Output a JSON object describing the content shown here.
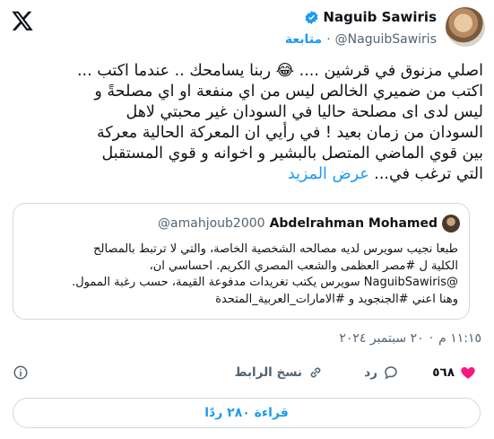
{
  "author": {
    "name": "Naguib Sawiris",
    "handle": "@NaguibSawiris",
    "follow_label": "متابعة",
    "dot": "·"
  },
  "tweet": {
    "lines": [
      "اصلي مزنوق في قرشين .... 😂 ربنا يسامحك .. عندما  اكتب ...",
      "اكتب من ضميري الخالص ليس من اي منفعة او اي مصلحةً و",
      "ليس لدى اى  مصلحة حاليا في السودان غير محبتي لاهل",
      "السودان من زمان بعيد ! في رأيي  ان المعركة الحالية معركة",
      "بين قوي الماضي المتصل بالبشير و اخوانه و قوي المستقبل"
    ],
    "last_line": "التي ترغب في...",
    "more_label": "عرض المزيد"
  },
  "quote": {
    "name": "Abdelrahman Mohamed",
    "handle": "@amahjoub2000",
    "lines": [
      "طبعا نجيب سويرس لديه مصالحه الشخصية الخاصة، والتي لا ترتبط بالمصالح",
      "الكلية ل #مصر العظمى والشعب المصري الكريم. احساسي ان،",
      "@NaguibSawiris سويرس يكتب تغريدات مدفوعة القيمة، حسب رغبة الممول.",
      "وهنا اعني #الجنجويد و #الامارات_العربية_المتحدة"
    ]
  },
  "timestamp": {
    "time": "١١:١٥ م",
    "dot": "·",
    "date": "٢٠ سبتمبر ٢٠٢٤"
  },
  "actions": {
    "like_count": "٥٦٨",
    "reply_label": "رد",
    "copy_label": "نسخ الرابط"
  },
  "read_replies_label": "قراءة ٢٨٠ ردًا",
  "colors": {
    "accent": "#1d9bf0",
    "like": "#f91880",
    "muted": "#536471"
  }
}
